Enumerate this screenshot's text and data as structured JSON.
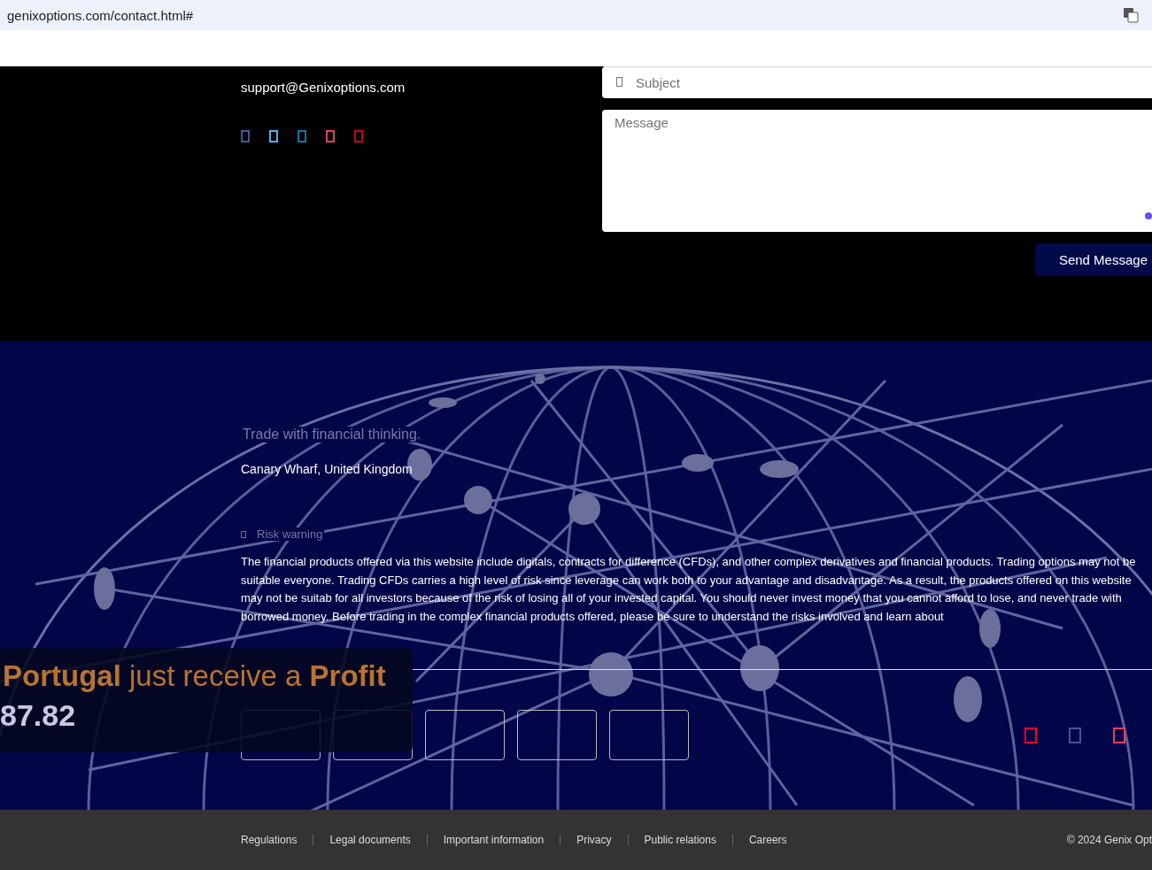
{
  "browser": {
    "url": "genixoptions.com/contact.html#"
  },
  "contact": {
    "email": "support@Genixoptions.com",
    "social_icons": [
      {
        "color": "#3b5998"
      },
      {
        "color": "#55acee"
      },
      {
        "color": "#0e76a8"
      },
      {
        "color": "#e4405f"
      },
      {
        "color": "#bd081c"
      }
    ]
  },
  "form": {
    "subject_placeholder": "Subject",
    "message_placeholder": "Message",
    "send_button": "Send Message"
  },
  "company": {
    "tagline": "Trade with financial thinking.",
    "address": "Canary Wharf, United Kingdom",
    "risk_heading": "Risk warning",
    "risk_text": "The financial products offered via this website include digitals, contracts for difference (CFDs), and other complex derivatives and financial products. Trading options may not be suitable everyone. Trading CFDs carries a high level of risk since leverage can work both to your advantage and disadvantage. As a result, the products offered on this website may not be suitab for all investors because of the risk of losing all of your invested capital. You should never invest money that you cannot afford to lose, and never trade with borrowed money. Before trading in the complex financial products offered, please be sure to understand the risks involved and learn about"
  },
  "bottom_icons": [
    {
      "color": "#ff0022"
    },
    {
      "color": "#3b5998"
    },
    {
      "color": "#e4405f"
    }
  ],
  "notification": {
    "text": "**Portugal** just receive a **Profit**",
    "amount": "87.82"
  },
  "footer_links": [
    "Regulations",
    "Legal documents",
    "Important information",
    "Privacy",
    "Public relations",
    "Careers"
  ],
  "copyright": "© 2024 Genix Opt"
}
